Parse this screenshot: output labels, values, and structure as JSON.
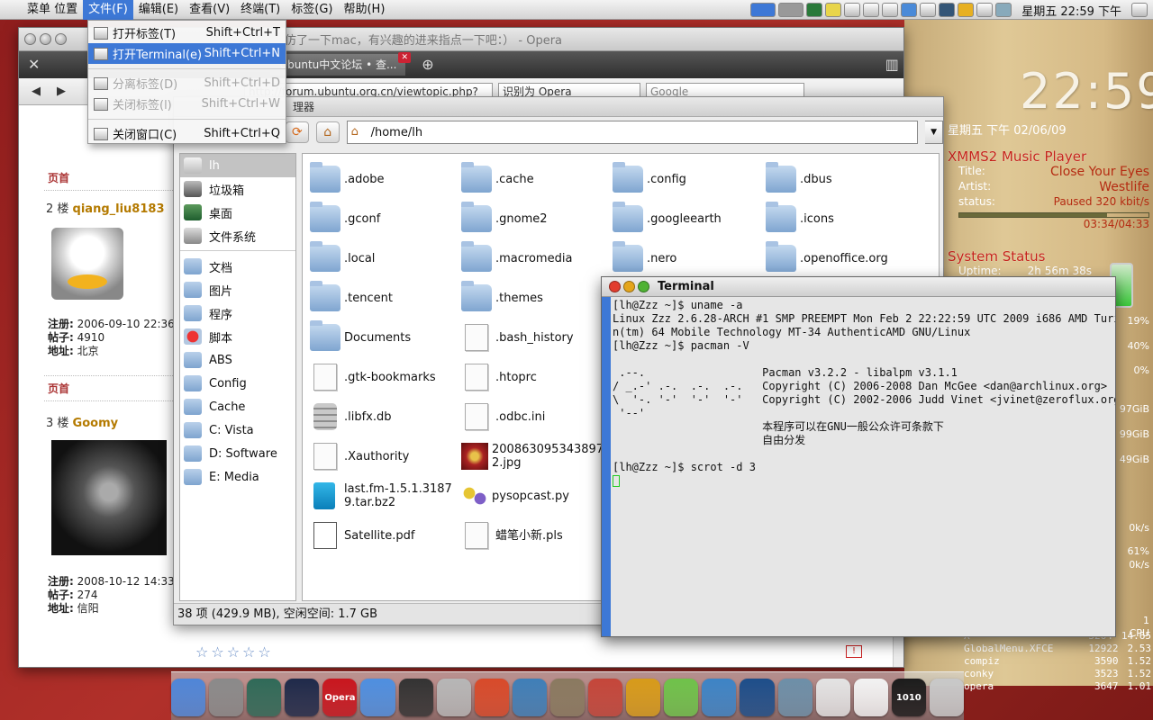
{
  "menubar": {
    "apple_icon": "apple-logo-icon",
    "items": [
      "菜单 位置",
      "文件(F)",
      "编辑(E)",
      "查看(V)",
      "终端(T)",
      "标签(G)",
      "帮助(H)"
    ],
    "active_index": 1,
    "clock": "星期五 22:59 下午"
  },
  "file_menu": {
    "items": [
      {
        "label": "打开标签(T)",
        "shortcut": "Shift+Ctrl+T",
        "state": "normal"
      },
      {
        "label": "打开Terminal(e)",
        "shortcut": "Shift+Ctrl+N",
        "state": "selected"
      },
      {
        "label": "分离标签(D)",
        "shortcut": "Shift+Ctrl+D",
        "state": "disabled"
      },
      {
        "label": "关闭标签(l)",
        "shortcut": "Shift+Ctrl+W",
        "state": "disabled"
      },
      {
        "label": "关闭窗口(C)",
        "shortcut": "Shift+Ctrl+Q",
        "state": "normal"
      }
    ]
  },
  "opera": {
    "title": "Ubuntu中文论坛 • 查看主题 - 仿了一下mac，有兴趣的进来指点一下吧：） - Opera",
    "title_visible": "仿了一下mac，有兴趣的进来指点一下吧：） - Opera",
    "tab": "Ubuntu中文论坛 • 查...",
    "tab_close": "✕",
    "address": "http://forum.ubuntu.org.cn/viewtopic.php?",
    "identify": "识别为 Opera",
    "search_placeholder": "Google",
    "forum": {
      "page_top_1": "页首",
      "post2_floor": "2 楼",
      "post2_user": "qiang_liu8183",
      "post2_reg_label": "注册:",
      "post2_reg": "2006-09-10 22:36",
      "post2_posts_label": "帖子:",
      "post2_posts": "4910",
      "post2_addr_label": "地址:",
      "post2_addr": "北京",
      "page_top_2": "页首",
      "post3_floor": "3 楼",
      "post3_user": "Goomy",
      "post3_reg_label": "注册:",
      "post3_reg": "2008-10-12 14:33",
      "post3_posts_label": "帖子:",
      "post3_posts": "274",
      "post3_addr_label": "地址:",
      "post3_addr": "信阳",
      "stars": "☆☆☆☆☆",
      "flag": "!"
    }
  },
  "file_manager": {
    "title": "理器",
    "path": "/home/lh",
    "sidebar": [
      {
        "label": "lh",
        "icon": "home-icon",
        "kind": "home"
      },
      {
        "label": "垃圾箱",
        "icon": "trash-icon",
        "kind": "trash"
      },
      {
        "label": "桌面",
        "icon": "desktop-icon",
        "kind": "desk"
      },
      {
        "label": "文件系统",
        "icon": "drive-icon",
        "kind": "disk"
      },
      {
        "label": "文档",
        "icon": "folder-icon",
        "kind": "dir"
      },
      {
        "label": "图片",
        "icon": "folder-icon",
        "kind": "dir"
      },
      {
        "label": "程序",
        "icon": "folder-icon",
        "kind": "dir"
      },
      {
        "label": "脚本",
        "icon": "folder-icon",
        "kind": "red"
      },
      {
        "label": "ABS",
        "icon": "folder-icon",
        "kind": "dir"
      },
      {
        "label": "Config",
        "icon": "folder-icon",
        "kind": "dir"
      },
      {
        "label": "Cache",
        "icon": "folder-icon",
        "kind": "dir"
      },
      {
        "label": "C: Vista",
        "icon": "folder-icon",
        "kind": "dir"
      },
      {
        "label": "D: Software",
        "icon": "folder-icon",
        "kind": "dir"
      },
      {
        "label": "E: Media",
        "icon": "folder-icon",
        "kind": "dir"
      }
    ],
    "files": [
      {
        "name": ".adobe",
        "type": "folder"
      },
      {
        "name": ".cache",
        "type": "folder"
      },
      {
        "name": ".config",
        "type": "folder"
      },
      {
        "name": ".dbus",
        "type": "folder"
      },
      {
        "name": ".gconf",
        "type": "folder"
      },
      {
        "name": ".gnome2",
        "type": "folder"
      },
      {
        "name": ".googleearth",
        "type": "folder"
      },
      {
        "name": ".icons",
        "type": "folder"
      },
      {
        "name": ".local",
        "type": "folder"
      },
      {
        "name": ".macromedia",
        "type": "folder"
      },
      {
        "name": ".nero",
        "type": "folder"
      },
      {
        "name": ".openoffice.org",
        "type": "folder"
      },
      {
        "name": ".tencent",
        "type": "folder"
      },
      {
        "name": ".themes",
        "type": "folder"
      },
      {
        "name": "Documents",
        "type": "folder"
      },
      {
        "name": ".bash_history",
        "type": "doc"
      },
      {
        "name": ".gtk-bookmarks",
        "type": "doc"
      },
      {
        "name": ".htoprc",
        "type": "doc"
      },
      {
        "name": ".libfx.db",
        "type": "db"
      },
      {
        "name": ".odbc.ini",
        "type": "doc"
      },
      {
        "name": ".Xauthority",
        "type": "doc"
      },
      {
        "name": "200863095343897 2.jpg",
        "type": "img"
      },
      {
        "name": "last.fm-1.5.1.3187 9.tar.bz2",
        "type": "arc"
      },
      {
        "name": "pysopcast.py",
        "type": "py"
      },
      {
        "name": "Satellite.pdf",
        "type": "pdf"
      },
      {
        "name": "蜡笔小新.pls",
        "type": "doc"
      }
    ],
    "status": "38 项 (429.9 MB), 空闲空间:  1.7 GB"
  },
  "terminal": {
    "title": "Terminal",
    "lines": [
      "[lh@Zzz ~]$ uname -a",
      "Linux Zzz 2.6.28-ARCH #1 SMP PREEMPT Mon Feb 2 22:22:59 UTC 2009 i686 AMD Turio",
      "n(tm) 64 Mobile Technology MT-34 AuthenticAMD GNU/Linux",
      "[lh@Zzz ~]$ pacman -V",
      "",
      " .--.                  Pacman v3.2.2 - libalpm v3.1.1",
      "/ _.-' .-.  .-.  .-.   Copyright (C) 2006-2008 Dan McGee <dan@archlinux.org>",
      "\\  '-. '-'  '-'  '-'   Copyright (C) 2002-2006 Judd Vinet <jvinet@zeroflux.org>",
      " '--'",
      "                       本程序可以在GNU一般公众许可条款下",
      "                       自由分发",
      "",
      "[lh@Zzz ~]$ scrot -d 3"
    ]
  },
  "desktop": {
    "clock": "22:59",
    "date": "星期五 下午  02/06/09",
    "xmms": {
      "title": "XMMS2 Music Player",
      "title_label": "Title:",
      "title_value": "Close Your Eyes",
      "artist_label": "Artist:",
      "artist_value": "Westlife",
      "status_label": "status:",
      "status_value": "Paused",
      "bitrate": "320 kbit/s",
      "time": "03:34/04:33",
      "progress": 0.78
    },
    "system": {
      "title": "System Status",
      "uptime_label": "Uptime:",
      "uptime_value": "2h 56m 38s"
    },
    "side_values": [
      "19%",
      "40%",
      "0%",
      "97GiB",
      "99GiB",
      "49GiB",
      "0k/s",
      "61%",
      "0k/s",
      "1",
      "CPU"
    ],
    "processes": [
      {
        "name": "X",
        "pid": "3264",
        "cpu": "14.65"
      },
      {
        "name": "GlobalMenu.XFCE",
        "pid": "12922",
        "cpu": "2.53"
      },
      {
        "name": "compiz",
        "pid": "3590",
        "cpu": "1.52"
      },
      {
        "name": "conky",
        "pid": "3523",
        "cpu": "1.52"
      },
      {
        "name": "opera",
        "pid": "3647",
        "cpu": "1.01"
      }
    ]
  },
  "dock": {
    "items": [
      {
        "name": "finder-icon",
        "color": "#4f86d8",
        "text": ""
      },
      {
        "name": "system-prefs-icon",
        "color": "#8a8a8a",
        "text": ""
      },
      {
        "name": "time-machine-icon",
        "color": "#2f6a58",
        "text": ""
      },
      {
        "name": "activity-monitor-icon",
        "color": "#1f2a4a",
        "text": ""
      },
      {
        "name": "opera-icon",
        "color": "#c8161e",
        "text": "Opera"
      },
      {
        "name": "ichat-icon",
        "color": "#4e8fe0",
        "text": ""
      },
      {
        "name": "qq-penguin-icon",
        "color": "#333333",
        "text": ""
      },
      {
        "name": "installer-icon",
        "color": "#b6b6b6",
        "text": ""
      },
      {
        "name": "preview-icon",
        "color": "#d84a2a",
        "text": ""
      },
      {
        "name": "iphoto-icon",
        "color": "#3f7fb8",
        "text": ""
      },
      {
        "name": "gimp-icon",
        "color": "#8a7a60",
        "text": ""
      },
      {
        "name": "mail-icon",
        "color": "#c4463a",
        "text": ""
      },
      {
        "name": "x11-icon",
        "color": "#d79b1a",
        "text": ""
      },
      {
        "name": "adium-icon",
        "color": "#6fc24a",
        "text": ""
      },
      {
        "name": "itunes-icon",
        "color": "#3d84c6",
        "text": ""
      },
      {
        "name": "movie-icon",
        "color": "#1d4e8a",
        "text": ""
      },
      {
        "name": "spaces-icon",
        "color": "#6d8fa8",
        "text": ""
      },
      {
        "name": "text-editor-icon",
        "color": "#e3e3e3",
        "text": ""
      },
      {
        "name": "pages-icon",
        "color": "#f2f2f2",
        "text": ""
      },
      {
        "name": "terminal-icon",
        "color": "#1b1b1b",
        "text": "1010"
      },
      {
        "name": "trash-dock-icon",
        "color": "#c8c8c8",
        "text": ""
      }
    ]
  }
}
